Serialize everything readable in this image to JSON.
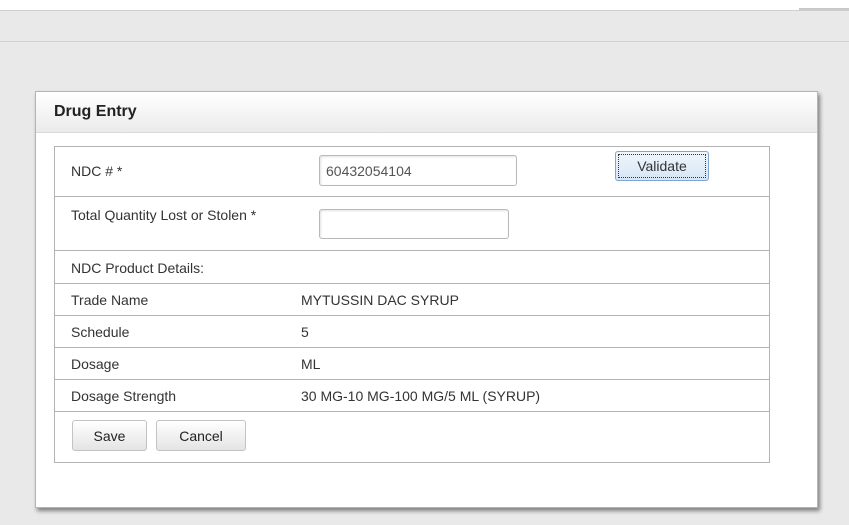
{
  "dialog": {
    "title": "Drug Entry"
  },
  "form": {
    "ndc": {
      "label": "NDC # *",
      "value": "60432054104",
      "validate_label": "Validate"
    },
    "quantity": {
      "label": "Total Quantity Lost or Stolen *",
      "value": ""
    },
    "details_heading": "NDC Product Details:",
    "details": [
      {
        "label": "Trade Name",
        "value": "MYTUSSIN DAC SYRUP"
      },
      {
        "label": "Schedule",
        "value": "5"
      },
      {
        "label": "Dosage",
        "value": "ML"
      },
      {
        "label": "Dosage Strength",
        "value": "30 MG-10 MG-100 MG/5 ML (SYRUP)"
      }
    ],
    "actions": {
      "save_label": "Save",
      "cancel_label": "Cancel"
    }
  },
  "colors": {
    "backdrop": "#e9e9e9",
    "border": "#b3b3b3",
    "validate_button_bg": "#d6e6f5",
    "text": "#333333"
  }
}
